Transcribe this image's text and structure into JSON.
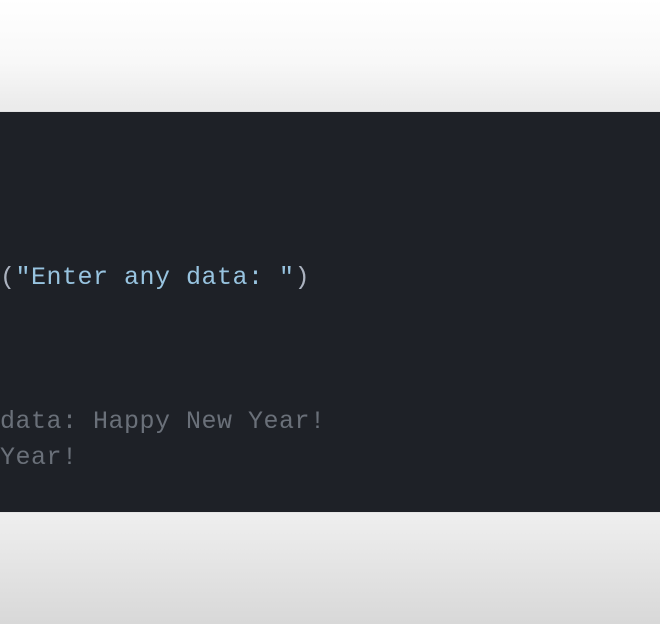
{
  "code": {
    "open_paren": "(",
    "string_literal": "\"Enter any data: \"",
    "close_paren": ")"
  },
  "output": {
    "line1": "data: Happy New Year!",
    "line2": "Year!"
  }
}
